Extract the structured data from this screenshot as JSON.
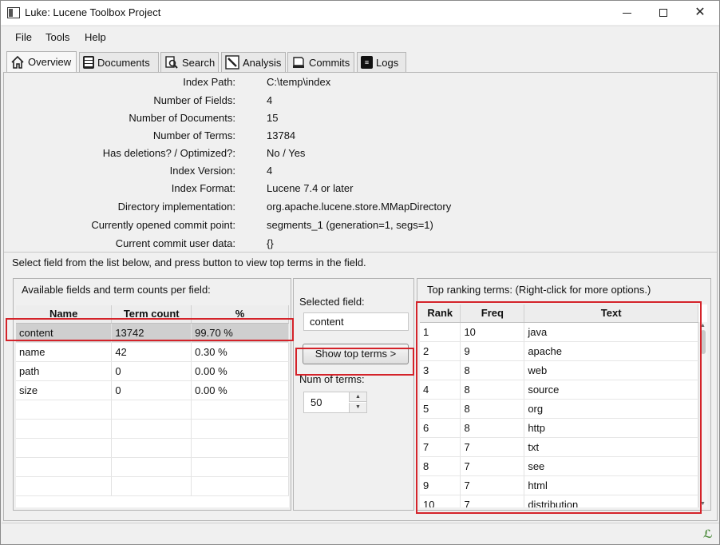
{
  "window": {
    "title": "Luke: Lucene Toolbox Project"
  },
  "menu": {
    "items": [
      "File",
      "Tools",
      "Help"
    ]
  },
  "tabs": [
    {
      "label": "Overview",
      "icon": "home-icon"
    },
    {
      "label": "Documents",
      "icon": "documents-icon"
    },
    {
      "label": "Search",
      "icon": "search-icon"
    },
    {
      "label": "Analysis",
      "icon": "analysis-icon"
    },
    {
      "label": "Commits",
      "icon": "commits-icon"
    },
    {
      "label": "Logs",
      "icon": "logs-icon"
    }
  ],
  "overview": {
    "info": [
      {
        "label": "Index Path:",
        "value": "C:\\temp\\index"
      },
      {
        "label": "Number of Fields:",
        "value": "4"
      },
      {
        "label": "Number of Documents:",
        "value": "15"
      },
      {
        "label": "Number of Terms:",
        "value": "13784"
      },
      {
        "label": "Has deletions? / Optimized?:",
        "value": "No / Yes"
      },
      {
        "label": "Index Version:",
        "value": "4"
      },
      {
        "label": "Index Format:",
        "value": "Lucene 7.4 or later"
      },
      {
        "label": "Directory implementation:",
        "value": "org.apache.lucene.store.MMapDirectory"
      },
      {
        "label": "Currently opened commit point:",
        "value": "segments_1 (generation=1, segs=1)"
      },
      {
        "label": "Current commit user data:",
        "value": "{}"
      }
    ],
    "hint": "Select field from the list below, and press button to view top terms in the field."
  },
  "fields_pane": {
    "title": "Available fields and term counts per field:",
    "headers": [
      "Name",
      "Term count",
      "%"
    ],
    "rows": [
      [
        "content",
        "13742",
        "99.70 %"
      ],
      [
        "name",
        "42",
        "0.30 %"
      ],
      [
        "path",
        "0",
        "0.00 %"
      ],
      [
        "size",
        "0",
        "0.00 %"
      ]
    ]
  },
  "controls": {
    "selected_field_label": "Selected field:",
    "selected_field_value": "content",
    "show_button": "Show top terms >",
    "num_terms_label": "Num of terms:",
    "num_terms_value": "50"
  },
  "terms_pane": {
    "title": "Top ranking terms: (Right-click for more options.)",
    "headers": [
      "Rank",
      "Freq",
      "Text"
    ],
    "rows": [
      [
        "1",
        "10",
        "java"
      ],
      [
        "2",
        "9",
        "apache"
      ],
      [
        "3",
        "8",
        "web"
      ],
      [
        "4",
        "8",
        "source"
      ],
      [
        "5",
        "8",
        "org"
      ],
      [
        "6",
        "8",
        "http"
      ],
      [
        "7",
        "7",
        "txt"
      ],
      [
        "8",
        "7",
        "see"
      ],
      [
        "9",
        "7",
        "html"
      ],
      [
        "10",
        "7",
        "distribution"
      ]
    ]
  },
  "colors": {
    "highlight": "#d4232a",
    "selection": "#cfcfcf"
  }
}
